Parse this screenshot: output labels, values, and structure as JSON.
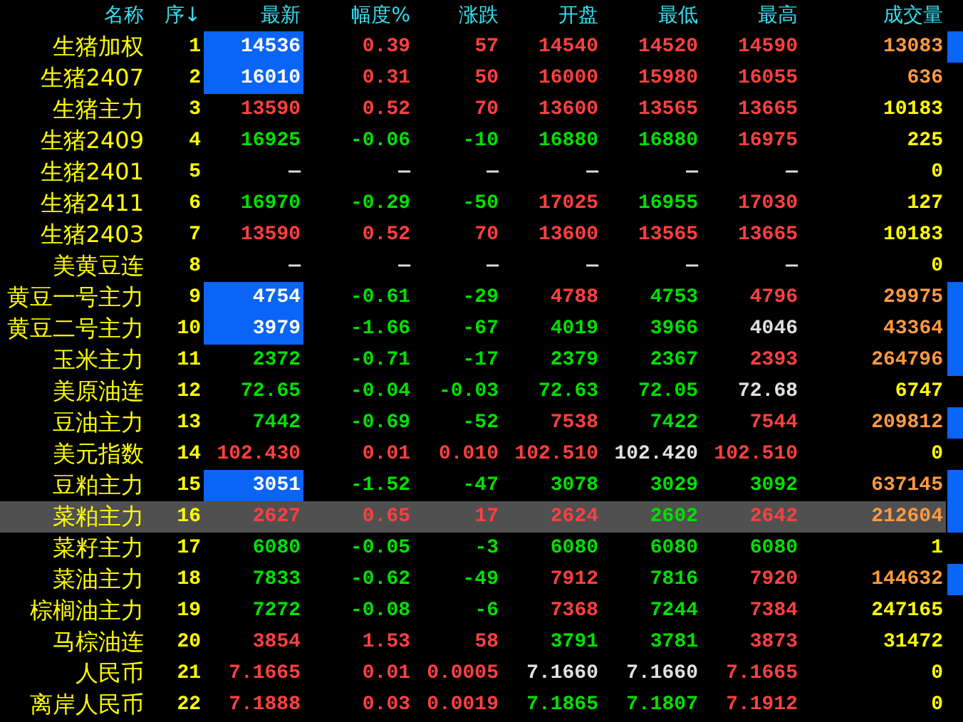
{
  "columns": [
    "名称",
    "序↓",
    "最新",
    "幅度%",
    "涨跌",
    "开盘",
    "最低",
    "最高",
    "成交量"
  ],
  "rows": [
    {
      "name": "生猪加权",
      "seq": "1",
      "selected": false,
      "flash": true,
      "marker": true,
      "cells": [
        {
          "text": "14536",
          "color": "#ffffff"
        },
        {
          "text": "0.39",
          "color": "#ff4040"
        },
        {
          "text": "57",
          "color": "#ff4040"
        },
        {
          "text": "14540",
          "color": "#ff4040"
        },
        {
          "text": "14520",
          "color": "#ff4040"
        },
        {
          "text": "14590",
          "color": "#ff4040"
        },
        {
          "text": "13083",
          "color": "#ff9a40"
        }
      ]
    },
    {
      "name": "生猪2407",
      "seq": "2",
      "selected": false,
      "flash": true,
      "marker": false,
      "cells": [
        {
          "text": "16010",
          "color": "#ffffff"
        },
        {
          "text": "0.31",
          "color": "#ff4040"
        },
        {
          "text": "50",
          "color": "#ff4040"
        },
        {
          "text": "16000",
          "color": "#ff4040"
        },
        {
          "text": "15980",
          "color": "#ff4040"
        },
        {
          "text": "16055",
          "color": "#ff4040"
        },
        {
          "text": "636",
          "color": "#ff9a40"
        }
      ]
    },
    {
      "name": "生猪主力",
      "seq": "3",
      "selected": false,
      "flash": false,
      "marker": false,
      "cells": [
        {
          "text": "13590",
          "color": "#ff4040"
        },
        {
          "text": "0.52",
          "color": "#ff4040"
        },
        {
          "text": "70",
          "color": "#ff4040"
        },
        {
          "text": "13600",
          "color": "#ff4040"
        },
        {
          "text": "13565",
          "color": "#ff4040"
        },
        {
          "text": "13665",
          "color": "#ff4040"
        },
        {
          "text": "10183",
          "color": "#ffff00"
        }
      ]
    },
    {
      "name": "生猪2409",
      "seq": "4",
      "selected": false,
      "flash": false,
      "marker": false,
      "cells": [
        {
          "text": "16925",
          "color": "#00e000"
        },
        {
          "text": "-0.06",
          "color": "#00e000"
        },
        {
          "text": "-10",
          "color": "#00e000"
        },
        {
          "text": "16880",
          "color": "#00e000"
        },
        {
          "text": "16880",
          "color": "#00e000"
        },
        {
          "text": "16975",
          "color": "#ff4040"
        },
        {
          "text": "225",
          "color": "#ffff00"
        }
      ]
    },
    {
      "name": "生猪2401",
      "seq": "5",
      "selected": false,
      "flash": false,
      "marker": false,
      "cells": [
        {
          "text": "—",
          "color": "#e0e0e0"
        },
        {
          "text": "—",
          "color": "#e0e0e0"
        },
        {
          "text": "—",
          "color": "#e0e0e0"
        },
        {
          "text": "—",
          "color": "#e0e0e0"
        },
        {
          "text": "—",
          "color": "#e0e0e0"
        },
        {
          "text": "—",
          "color": "#e0e0e0"
        },
        {
          "text": "0",
          "color": "#ffff00"
        }
      ]
    },
    {
      "name": "生猪2411",
      "seq": "6",
      "selected": false,
      "flash": false,
      "marker": false,
      "cells": [
        {
          "text": "16970",
          "color": "#00e000"
        },
        {
          "text": "-0.29",
          "color": "#00e000"
        },
        {
          "text": "-50",
          "color": "#00e000"
        },
        {
          "text": "17025",
          "color": "#ff4040"
        },
        {
          "text": "16955",
          "color": "#00e000"
        },
        {
          "text": "17030",
          "color": "#ff4040"
        },
        {
          "text": "127",
          "color": "#ffff00"
        }
      ]
    },
    {
      "name": "生猪2403",
      "seq": "7",
      "selected": false,
      "flash": false,
      "marker": false,
      "cells": [
        {
          "text": "13590",
          "color": "#ff4040"
        },
        {
          "text": "0.52",
          "color": "#ff4040"
        },
        {
          "text": "70",
          "color": "#ff4040"
        },
        {
          "text": "13600",
          "color": "#ff4040"
        },
        {
          "text": "13565",
          "color": "#ff4040"
        },
        {
          "text": "13665",
          "color": "#ff4040"
        },
        {
          "text": "10183",
          "color": "#ffff00"
        }
      ]
    },
    {
      "name": "美黄豆连",
      "seq": "8",
      "selected": false,
      "flash": false,
      "marker": false,
      "cells": [
        {
          "text": "—",
          "color": "#e0e0e0"
        },
        {
          "text": "—",
          "color": "#e0e0e0"
        },
        {
          "text": "—",
          "color": "#e0e0e0"
        },
        {
          "text": "—",
          "color": "#e0e0e0"
        },
        {
          "text": "—",
          "color": "#e0e0e0"
        },
        {
          "text": "—",
          "color": "#e0e0e0"
        },
        {
          "text": "0",
          "color": "#ffff00"
        }
      ]
    },
    {
      "name": "黄豆一号主力",
      "seq": "9",
      "selected": false,
      "flash": true,
      "marker": true,
      "cells": [
        {
          "text": "4754",
          "color": "#ffffff"
        },
        {
          "text": "-0.61",
          "color": "#00e000"
        },
        {
          "text": "-29",
          "color": "#00e000"
        },
        {
          "text": "4788",
          "color": "#ff4040"
        },
        {
          "text": "4753",
          "color": "#00e000"
        },
        {
          "text": "4796",
          "color": "#ff4040"
        },
        {
          "text": "29975",
          "color": "#ff9a40"
        }
      ]
    },
    {
      "name": "黄豆二号主力",
      "seq": "10",
      "selected": false,
      "flash": true,
      "marker": true,
      "cells": [
        {
          "text": "3979",
          "color": "#ffffff"
        },
        {
          "text": "-1.66",
          "color": "#00e000"
        },
        {
          "text": "-67",
          "color": "#00e000"
        },
        {
          "text": "4019",
          "color": "#00e000"
        },
        {
          "text": "3966",
          "color": "#00e000"
        },
        {
          "text": "4046",
          "color": "#e0e0e0"
        },
        {
          "text": "43364",
          "color": "#ff9a40"
        }
      ]
    },
    {
      "name": "玉米主力",
      "seq": "11",
      "selected": false,
      "flash": false,
      "marker": true,
      "cells": [
        {
          "text": "2372",
          "color": "#00e000"
        },
        {
          "text": "-0.71",
          "color": "#00e000"
        },
        {
          "text": "-17",
          "color": "#00e000"
        },
        {
          "text": "2379",
          "color": "#00e000"
        },
        {
          "text": "2367",
          "color": "#00e000"
        },
        {
          "text": "2393",
          "color": "#ff4040"
        },
        {
          "text": "264796",
          "color": "#ff9a40"
        }
      ]
    },
    {
      "name": "美原油连",
      "seq": "12",
      "selected": false,
      "flash": false,
      "marker": false,
      "cells": [
        {
          "text": "72.65",
          "color": "#00e000"
        },
        {
          "text": "-0.04",
          "color": "#00e000"
        },
        {
          "text": "-0.03",
          "color": "#00e000"
        },
        {
          "text": "72.63",
          "color": "#00e000"
        },
        {
          "text": "72.05",
          "color": "#00e000"
        },
        {
          "text": "72.68",
          "color": "#e0e0e0"
        },
        {
          "text": "6747",
          "color": "#ffff00"
        }
      ]
    },
    {
      "name": "豆油主力",
      "seq": "13",
      "selected": false,
      "flash": false,
      "marker": true,
      "cells": [
        {
          "text": "7442",
          "color": "#00e000"
        },
        {
          "text": "-0.69",
          "color": "#00e000"
        },
        {
          "text": "-52",
          "color": "#00e000"
        },
        {
          "text": "7538",
          "color": "#ff4040"
        },
        {
          "text": "7422",
          "color": "#00e000"
        },
        {
          "text": "7544",
          "color": "#ff4040"
        },
        {
          "text": "209812",
          "color": "#ff9a40"
        }
      ]
    },
    {
      "name": "美元指数",
      "seq": "14",
      "selected": false,
      "flash": false,
      "marker": false,
      "cells": [
        {
          "text": "102.430",
          "color": "#ff4040"
        },
        {
          "text": "0.01",
          "color": "#ff4040"
        },
        {
          "text": "0.010",
          "color": "#ff4040"
        },
        {
          "text": "102.510",
          "color": "#ff4040"
        },
        {
          "text": "102.420",
          "color": "#e0e0e0"
        },
        {
          "text": "102.510",
          "color": "#ff4040"
        },
        {
          "text": "0",
          "color": "#ffff00"
        }
      ]
    },
    {
      "name": "豆粕主力",
      "seq": "15",
      "selected": false,
      "flash": true,
      "marker": true,
      "cells": [
        {
          "text": "3051",
          "color": "#ffffff"
        },
        {
          "text": "-1.52",
          "color": "#00e000"
        },
        {
          "text": "-47",
          "color": "#00e000"
        },
        {
          "text": "3078",
          "color": "#00e000"
        },
        {
          "text": "3029",
          "color": "#00e000"
        },
        {
          "text": "3092",
          "color": "#00e000"
        },
        {
          "text": "637145",
          "color": "#ff9a40"
        }
      ]
    },
    {
      "name": "菜粕主力",
      "seq": "16",
      "selected": true,
      "flash": false,
      "marker": true,
      "cells": [
        {
          "text": "2627",
          "color": "#ff4040"
        },
        {
          "text": "0.65",
          "color": "#ff4040"
        },
        {
          "text": "17",
          "color": "#ff4040"
        },
        {
          "text": "2624",
          "color": "#ff4040"
        },
        {
          "text": "2602",
          "color": "#00e000"
        },
        {
          "text": "2642",
          "color": "#ff4040"
        },
        {
          "text": "212604",
          "color": "#ff9a40"
        }
      ]
    },
    {
      "name": "菜籽主力",
      "seq": "17",
      "selected": false,
      "flash": false,
      "marker": false,
      "cells": [
        {
          "text": "6080",
          "color": "#00e000"
        },
        {
          "text": "-0.05",
          "color": "#00e000"
        },
        {
          "text": "-3",
          "color": "#00e000"
        },
        {
          "text": "6080",
          "color": "#00e000"
        },
        {
          "text": "6080",
          "color": "#00e000"
        },
        {
          "text": "6080",
          "color": "#00e000"
        },
        {
          "text": "1",
          "color": "#ffff00"
        }
      ]
    },
    {
      "name": "菜油主力",
      "seq": "18",
      "selected": false,
      "flash": false,
      "marker": true,
      "cells": [
        {
          "text": "7833",
          "color": "#00e000"
        },
        {
          "text": "-0.62",
          "color": "#00e000"
        },
        {
          "text": "-49",
          "color": "#00e000"
        },
        {
          "text": "7912",
          "color": "#ff4040"
        },
        {
          "text": "7816",
          "color": "#00e000"
        },
        {
          "text": "7920",
          "color": "#ff4040"
        },
        {
          "text": "144632",
          "color": "#ff9a40"
        }
      ]
    },
    {
      "name": "棕榈油主力",
      "seq": "19",
      "selected": false,
      "flash": false,
      "marker": false,
      "cells": [
        {
          "text": "7272",
          "color": "#00e000"
        },
        {
          "text": "-0.08",
          "color": "#00e000"
        },
        {
          "text": "-6",
          "color": "#00e000"
        },
        {
          "text": "7368",
          "color": "#ff4040"
        },
        {
          "text": "7244",
          "color": "#00e000"
        },
        {
          "text": "7384",
          "color": "#ff4040"
        },
        {
          "text": "247165",
          "color": "#ffff00"
        }
      ]
    },
    {
      "name": "马棕油连",
      "seq": "20",
      "selected": false,
      "flash": false,
      "marker": false,
      "cells": [
        {
          "text": "3854",
          "color": "#ff4040"
        },
        {
          "text": "1.53",
          "color": "#ff4040"
        },
        {
          "text": "58",
          "color": "#ff4040"
        },
        {
          "text": "3791",
          "color": "#00e000"
        },
        {
          "text": "3781",
          "color": "#00e000"
        },
        {
          "text": "3873",
          "color": "#ff4040"
        },
        {
          "text": "31472",
          "color": "#ffff00"
        }
      ]
    },
    {
      "name": "人民币",
      "seq": "21",
      "selected": false,
      "flash": false,
      "marker": false,
      "cells": [
        {
          "text": "7.1665",
          "color": "#ff4040"
        },
        {
          "text": "0.01",
          "color": "#ff4040"
        },
        {
          "text": "0.0005",
          "color": "#ff4040"
        },
        {
          "text": "7.1660",
          "color": "#e0e0e0"
        },
        {
          "text": "7.1660",
          "color": "#e0e0e0"
        },
        {
          "text": "7.1665",
          "color": "#ff4040"
        },
        {
          "text": "0",
          "color": "#ffff00"
        }
      ]
    },
    {
      "name": "离岸人民币",
      "seq": "22",
      "selected": false,
      "flash": false,
      "marker": false,
      "cells": [
        {
          "text": "7.1888",
          "color": "#ff4040"
        },
        {
          "text": "0.03",
          "color": "#ff4040"
        },
        {
          "text": "0.0019",
          "color": "#ff4040"
        },
        {
          "text": "7.1865",
          "color": "#00e000"
        },
        {
          "text": "7.1807",
          "color": "#00e000"
        },
        {
          "text": "7.1912",
          "color": "#ff4040"
        },
        {
          "text": "0",
          "color": "#ffff00"
        }
      ]
    }
  ]
}
